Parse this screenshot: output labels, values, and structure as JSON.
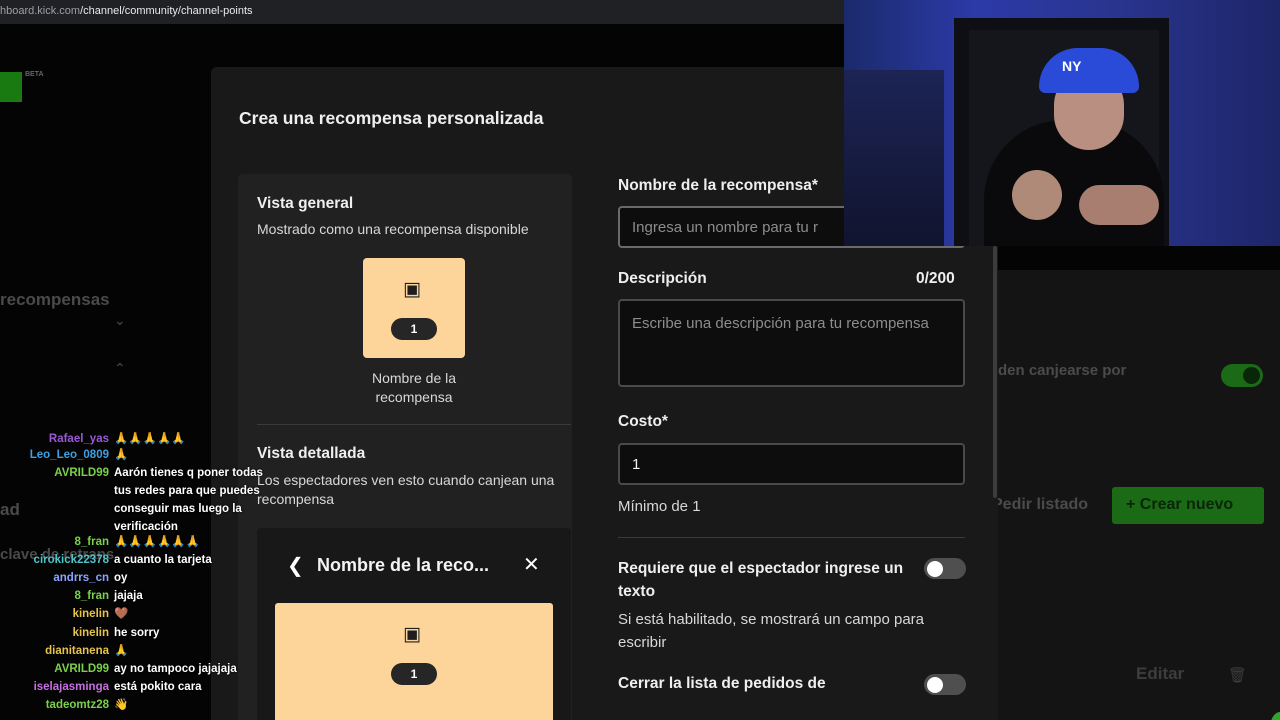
{
  "browser": {
    "url_prefix": "hboard.kick.com",
    "url_path": "/channel/community/channel-points"
  },
  "background": {
    "logo_badge": "BETA",
    "rewards_title": "recompensas",
    "left_label_1": "ad",
    "left_label_2": "clave de retrans",
    "right_row_text": "den canjearse por",
    "pedir_listado": "Pedir listado",
    "crear_nuevo": "Crear nuevo",
    "editar": "Editar"
  },
  "modal": {
    "title": "Crea una recompensa personalizada",
    "preview": {
      "general_title": "Vista general",
      "general_subtitle": "Mostrado como una recompensa disponible",
      "card_cost": "1",
      "card_name": "Nombre de la recompensa",
      "detail_title": "Vista detallada",
      "detail_subtitle": "Los espectadores ven esto cuando canjean una recompensa",
      "detail_header": "Nombre de la reco...",
      "detail_cost": "1"
    },
    "form": {
      "name_label": "Nombre de la recompensa*",
      "name_placeholder": "Ingresa un nombre para tu r",
      "description_label": "Descripción",
      "description_count": "0/200",
      "description_placeholder": "Escribe una descripción para tu recompensa",
      "cost_label": "Costo*",
      "cost_value": "1",
      "cost_hint": "Mínimo de 1",
      "require_text_label": "Requiere que el espectador ingrese un texto",
      "require_text_enabled": false,
      "require_text_hint": "Si está habilitado, se mostrará un campo para escribir",
      "close_queue_label": "Cerrar la lista de pedidos de",
      "close_queue_enabled": false
    }
  },
  "chat": [
    {
      "user": "Rafael_yas",
      "color": "#9b59d6",
      "text": "🙏🙏🙏🙏🙏"
    },
    {
      "user": "Leo_Leo_0809",
      "color": "#3fa0e0",
      "text": "🙏"
    },
    {
      "user": "AVRILD99",
      "color": "#7ad14b",
      "text": "Aarón tienes q poner todas tus redes para que puedes conseguir mas luego la verificación"
    },
    {
      "user": "8_fran",
      "color": "#7ad14b",
      "text": "🙏🙏🙏🙏🙏🙏"
    },
    {
      "user": "cirokick22378",
      "color": "#4fc3c8",
      "text": "a cuanto la tarjeta"
    },
    {
      "user": "andrrs_cn",
      "color": "#8aa4ff",
      "text": "oy"
    },
    {
      "user": "8_fran",
      "color": "#7ad14b",
      "text": "jajaja"
    },
    {
      "user": "kinelin",
      "color": "#e8c34b",
      "text": "🤎"
    },
    {
      "user": "kinelin",
      "color": "#e8c34b",
      "text": "he sorry"
    },
    {
      "user": "dianitanena",
      "color": "#e8c34b",
      "text": "🙏"
    },
    {
      "user": "AVRILD99",
      "color": "#7ad14b",
      "text": "ay no tampoco jajajaja"
    },
    {
      "user": "iselajasminga",
      "color": "#c66fe0",
      "text": "está pokito cara"
    },
    {
      "user": "tadeomtz28",
      "color": "#7ad14b",
      "text": "👋"
    }
  ],
  "webcam": {
    "hat_logo": "NY"
  }
}
